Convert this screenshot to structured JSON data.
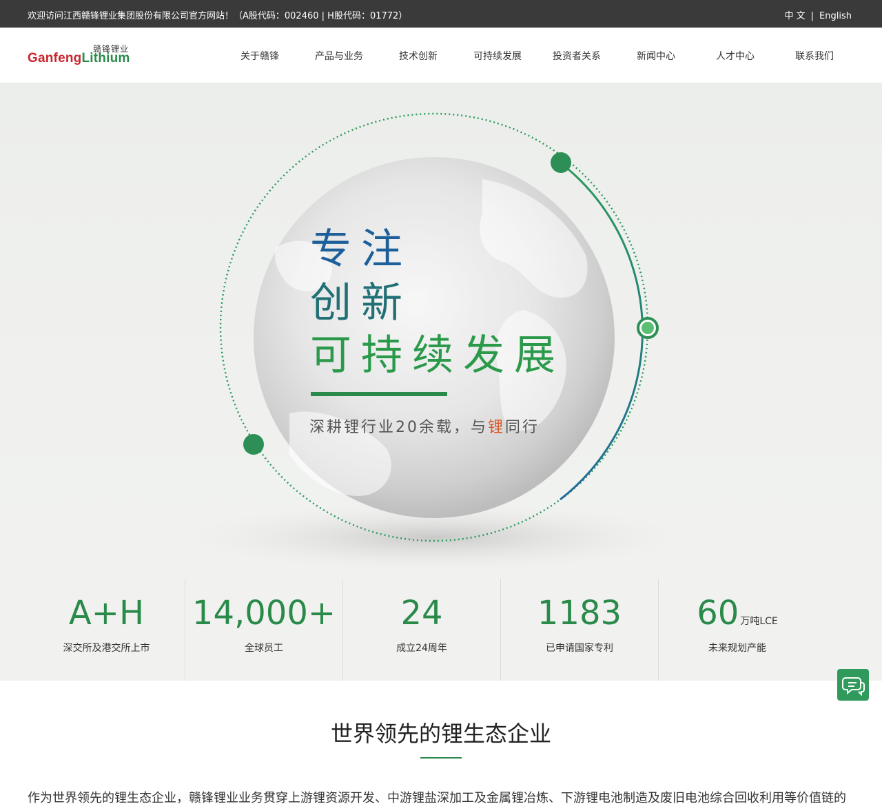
{
  "topbar": {
    "welcome": "欢迎访问江西赣锋锂业集团股份有限公司官方网站！（A股代码：002460 | H股代码：01772）",
    "lang_cn": "中 文",
    "lang_sep": "|",
    "lang_en": "English"
  },
  "logo": {
    "cn": "赣锋锂业",
    "en_part1": "Ganfeng",
    "en_part2": "Lithium"
  },
  "nav": {
    "items": [
      "关于赣锋",
      "产品与业务",
      "技术创新",
      "可持续发展",
      "投资者关系",
      "新闻中心",
      "人才中心",
      "联系我们"
    ]
  },
  "hero": {
    "line1": "专注",
    "line2": "创新",
    "line3": "可持续发展",
    "tagline_pre": "深耕锂行业20余载，与",
    "tagline_hl": "锂",
    "tagline_post": "同行"
  },
  "stats": [
    {
      "value": "A+H",
      "unit": "",
      "label": "深交所及港交所上市"
    },
    {
      "value": "14,000+",
      "unit": "",
      "label": "全球员工"
    },
    {
      "value": "24",
      "unit": "",
      "label": "成立24周年"
    },
    {
      "value": "1183",
      "unit": "",
      "label": "已申请国家专利"
    },
    {
      "value": "60",
      "unit": "万吨LCE",
      "label": "未来规划产能"
    }
  ],
  "intro": {
    "title": "世界领先的锂生态企业",
    "text": "作为世界领先的锂生态企业，赣锋锂业业务贯穿上游锂资源开发、中游锂盐深加工及金属锂冶炼、下游锂电池制造及废旧电池综合回收利用等价值链的"
  },
  "colors": {
    "brand_green": "#2a8a4a",
    "brand_red": "#c9252d",
    "brand_blue": "#1d5f9a",
    "topbar_bg": "#3a3a3a"
  },
  "icons": {
    "chat": "chat-bubble-icon"
  }
}
